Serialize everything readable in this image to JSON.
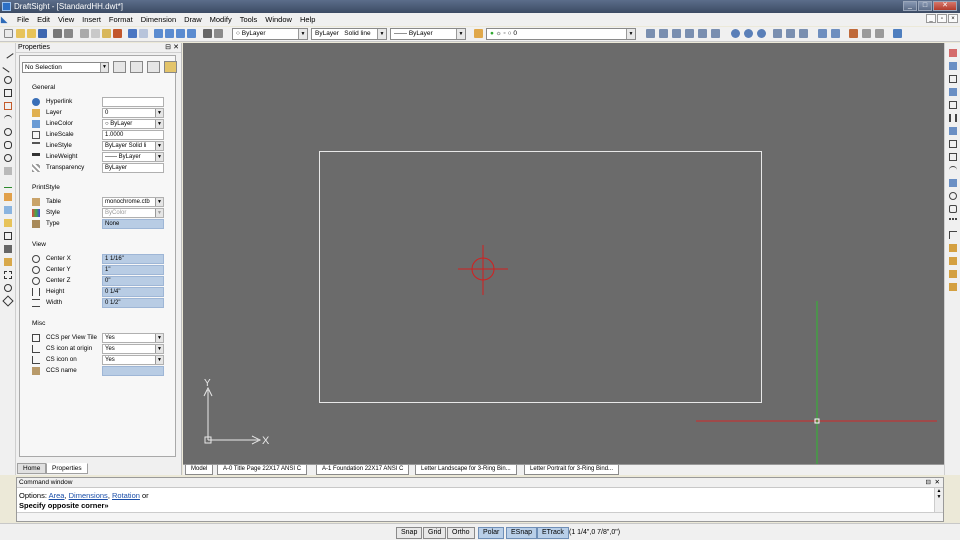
{
  "window": {
    "title": "DraftSight - [StandardHH.dwt*]",
    "minimize": "_",
    "maximize": "□",
    "close": "✕"
  },
  "menu": [
    "File",
    "Edit",
    "View",
    "Insert",
    "Format",
    "Dimension",
    "Draw",
    "Modify",
    "Tools",
    "Window",
    "Help"
  ],
  "toolbar": {
    "layer_combo": "ByLayer",
    "color_combo": "ByLayer",
    "linestyle_combo": "ByLayer",
    "linestyle_solid": "Solid line",
    "lineweight_combo": "ByLayer",
    "layer_state_combo": "0"
  },
  "properties": {
    "title": "Properties",
    "selection": "No Selection",
    "sections": {
      "general": "General",
      "printstyle": "PrintStyle",
      "view": "View",
      "misc": "Misc"
    },
    "general_rows": [
      {
        "label": "Hyperlink",
        "value": ""
      },
      {
        "label": "Layer",
        "value": "0"
      },
      {
        "label": "LineColor",
        "value": "ByLayer"
      },
      {
        "label": "LineScale",
        "value": "1.0000"
      },
      {
        "label": "LineStyle",
        "value": "ByLayer      Solid li"
      },
      {
        "label": "LineWeight",
        "value": "—— ByLayer"
      },
      {
        "label": "Transparency",
        "value": "ByLayer"
      }
    ],
    "printstyle_rows": [
      {
        "label": "Table",
        "value": "monochrome.ctb"
      },
      {
        "label": "Style",
        "value": "ByColor"
      },
      {
        "label": "Type",
        "value": "None"
      }
    ],
    "view_rows": [
      {
        "label": "Center X",
        "value": "1 1/16\""
      },
      {
        "label": "Center Y",
        "value": "1\""
      },
      {
        "label": "Center Z",
        "value": "0\""
      },
      {
        "label": "Height",
        "value": "0 1/4\""
      },
      {
        "label": "Width",
        "value": "0 1/2\""
      }
    ],
    "misc_rows": [
      {
        "label": "CCS per View Tile",
        "value": "Yes"
      },
      {
        "label": "CS icon at origin",
        "value": "Yes"
      },
      {
        "label": "CS icon on",
        "value": "Yes"
      },
      {
        "label": "CCS name",
        "value": ""
      }
    ],
    "tabs": [
      "Home",
      "Properties"
    ]
  },
  "layout_tabs": [
    "Model",
    "A-0 Title Page 22X17 ANSI C",
    "A-1 Foundation 22X17 ANSI C",
    "Letter Landscape for 3-Ring Bin...",
    "Letter Portrait for 3-Ring Bind..."
  ],
  "canvas": {
    "ucs_y": "Y",
    "ucs_x": "X"
  },
  "command": {
    "title": "Command window",
    "options_prefix": "Options: ",
    "opt_area": "Area",
    "opt_dimensions": "Dimensions",
    "opt_rotation": "Rotation",
    "options_suffix": " or",
    "prompt": "Specify opposite corner»"
  },
  "status": {
    "buttons": [
      "Snap",
      "Grid",
      "Ortho",
      "Polar",
      "ESnap",
      "ETrack"
    ],
    "active": [
      "Polar",
      "ESnap",
      "ETrack"
    ],
    "coords": "(1 1/4\",0 7/8\",0\")"
  },
  "colors": {
    "canvas_bg": "#6b6b6b",
    "crosshair_red": "#d31f1f",
    "cursor_x": "#d32a2a",
    "cursor_y": "#2fb82f",
    "field_highlight": "#b8cce4"
  }
}
